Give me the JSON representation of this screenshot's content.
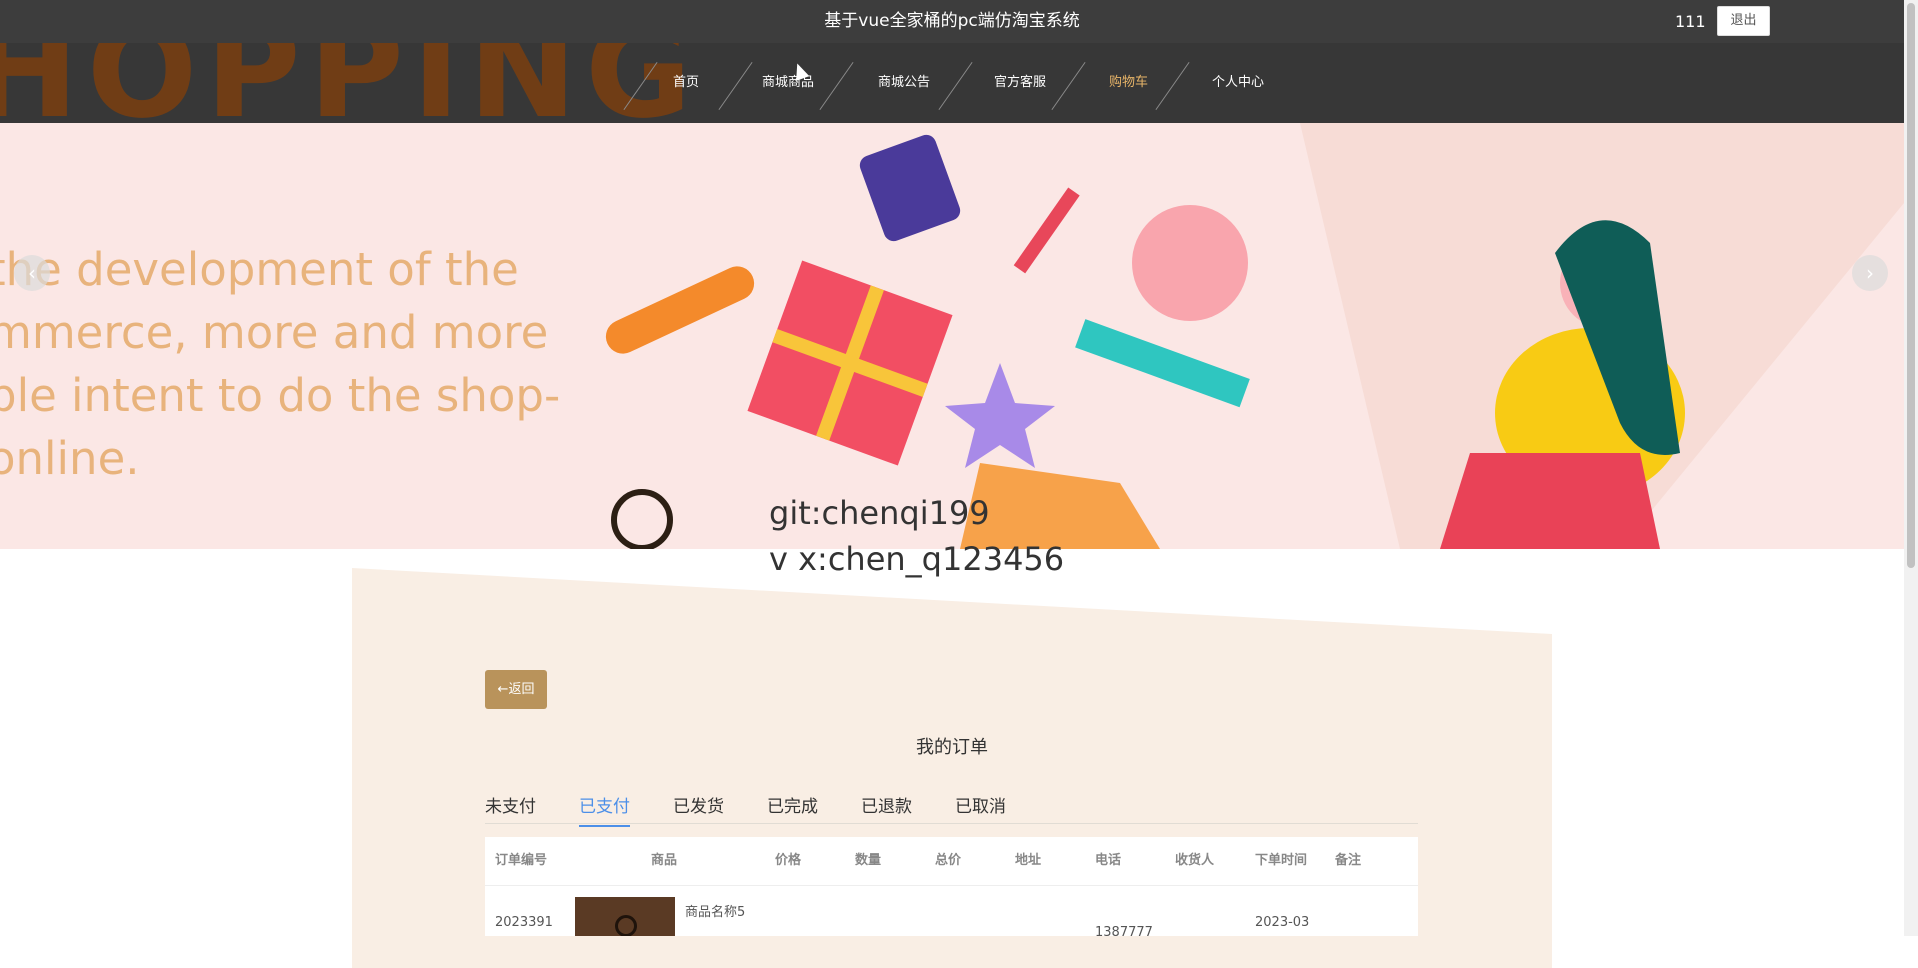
{
  "header": {
    "title": "基于vue全家桶的pc端仿淘宝系统",
    "username": "111",
    "logout_label": "退出"
  },
  "nav": {
    "banner_word": "HOPPING",
    "items": [
      {
        "label": "首页"
      },
      {
        "label": "商城商品"
      },
      {
        "label": "商城公告"
      },
      {
        "label": "官方客服"
      },
      {
        "label": "购物车"
      },
      {
        "label": "个人中心"
      }
    ],
    "active_index": 4
  },
  "banner": {
    "lines": [
      "the development of the",
      "mmerce, more and more",
      "ple intent to do the shop-",
      " online."
    ],
    "prev_label": "‹",
    "next_label": "›"
  },
  "watermark": {
    "line1": "git:chenqi199",
    "line2": "v x:chen_q123456"
  },
  "orders": {
    "back_label": "←返回",
    "title": "我的订单",
    "tabs": [
      "未支付",
      "已支付",
      "已发货",
      "已完成",
      "已退款",
      "已取消"
    ],
    "active_tab": 1,
    "columns": [
      "订单编号",
      "商品",
      "价格",
      "数量",
      "总价",
      "地址",
      "电话",
      "收货人",
      "下单时间",
      "备注"
    ],
    "rows": [
      {
        "order_no": "2023391",
        "product_name": "商品名称5",
        "phone": "1387777",
        "time": "2023-03"
      }
    ]
  },
  "colors": {
    "topbar": "#3d3d3d",
    "navbar": "#373737",
    "nav_active": "#e7b468",
    "accent": "#b9935b",
    "tab_active": "#4c8fe8",
    "panel": "#f9eee4"
  }
}
